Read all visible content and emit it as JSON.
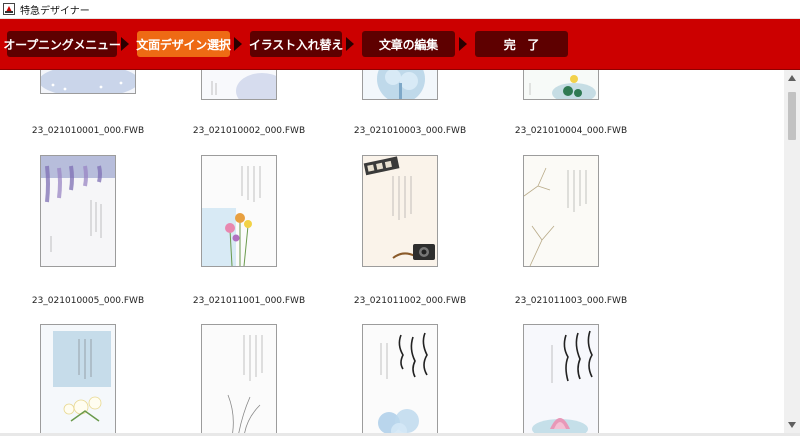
{
  "window": {
    "title": "特急デザイナー",
    "app_icon": "app-icon"
  },
  "steps": [
    {
      "label": "オープニングメニュー",
      "active": false
    },
    {
      "label": "文面デザイン選択",
      "active": true
    },
    {
      "label": "イラスト入れ替え",
      "active": false
    },
    {
      "label": "文章の編集",
      "active": false
    },
    {
      "label": "完　了",
      "active": false
    }
  ],
  "colors": {
    "step_bar": "#cc0000",
    "step_inactive": "#5e0000",
    "step_active": "#ee6a14"
  },
  "thumbnails": {
    "row1": [
      {
        "file": "23_021010001_000.FWB",
        "motif": "snowy-blue"
      },
      {
        "file": "23_021010002_000.FWB",
        "motif": "blue-wash"
      },
      {
        "file": "23_021010003_000.FWB",
        "motif": "frosted-tree"
      },
      {
        "file": "23_021010004_000.FWB",
        "motif": "lotus"
      }
    ],
    "row2": [
      {
        "file": "23_021010005_000.FWB",
        "motif": "wisteria"
      },
      {
        "file": "23_021011001_000.FWB",
        "motif": "flowers"
      },
      {
        "file": "23_021011002_000.FWB",
        "motif": "film-camera"
      },
      {
        "file": "23_021011003_000.FWB",
        "motif": "bare-branches"
      }
    ],
    "row3": [
      {
        "motif": "blue-lily"
      },
      {
        "motif": "grass"
      },
      {
        "motif": "calligraphy-hydrangea"
      },
      {
        "motif": "calligraphy-lotus"
      }
    ]
  },
  "scrollbar": {
    "up_icon": "scroll-up-arrow-icon",
    "down_icon": "scroll-down-arrow-icon"
  }
}
